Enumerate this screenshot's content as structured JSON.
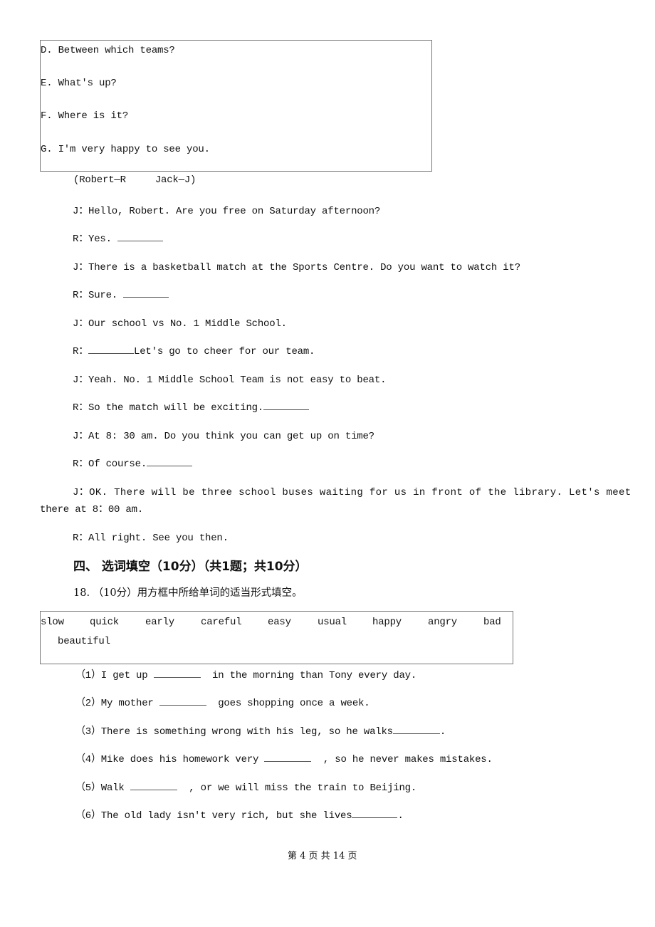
{
  "options_box": {
    "items": [
      "D. Between which teams?",
      "E. What's up?",
      "F. Where is it?",
      "G. I'm very happy to see you."
    ]
  },
  "dialogue": {
    "legend": "(Robert—R     Jack—J)",
    "lines": [
      {
        "before": "J：Hello, Robert. Are you free on Saturday afternoon?",
        "after": ""
      },
      {
        "before": "R：Yes. ",
        "blank": true,
        "after": ""
      },
      {
        "before": "J：There is a basketball match at the Sports Centre. Do you want to watch it?",
        "after": ""
      },
      {
        "before": "R：Sure. ",
        "blank": true,
        "after": ""
      },
      {
        "before": "J：Our school vs No. 1 Middle School.",
        "after": ""
      },
      {
        "before": "R：",
        "blank": true,
        "after": "Let's go to cheer for our team."
      },
      {
        "before": "J：Yeah. No. 1 Middle School Team is not easy to beat.",
        "after": ""
      },
      {
        "before": "R：So the match will be exciting.",
        "blank": true,
        "after": ""
      },
      {
        "before": "J：At 8: 30 am. Do you think you can get up on time?",
        "after": ""
      },
      {
        "before": "R：Of course.",
        "blank": true,
        "after": ""
      }
    ],
    "long_line_1": "J：OK. There will be three school buses waiting for us in front of the library. Let's meet",
    "long_line_2": "there at 8：00 am.",
    "last_line": "R：All right. See you then."
  },
  "section": {
    "heading": "四、 选词填空（10分）（共1题；共10分）",
    "question": "18. （10分）用方框中所给单词的适当形式填空。"
  },
  "word_box": {
    "words": [
      "slow",
      "quick",
      "early",
      "careful",
      "easy",
      "usual",
      "happy",
      "angry",
      "bad",
      "beautiful"
    ]
  },
  "fill_items": [
    {
      "before": "（1）I get up ",
      "after": "  in the morning than Tony every day."
    },
    {
      "before": "（2）My mother ",
      "after": "  goes shopping once a week."
    },
    {
      "before": "（3）There is something wrong with his leg, so he walks",
      "after": "."
    },
    {
      "before": "（4）Mike does his homework very ",
      "after": "  , so he never makes mistakes."
    },
    {
      "before": "（5）Walk ",
      "after": "  , or we will miss the train to Beijing."
    },
    {
      "before": "（6）The old lady isn't very rich, but she lives",
      "after": "."
    }
  ],
  "footer": {
    "page_text": "第 4 页 共 14 页"
  }
}
